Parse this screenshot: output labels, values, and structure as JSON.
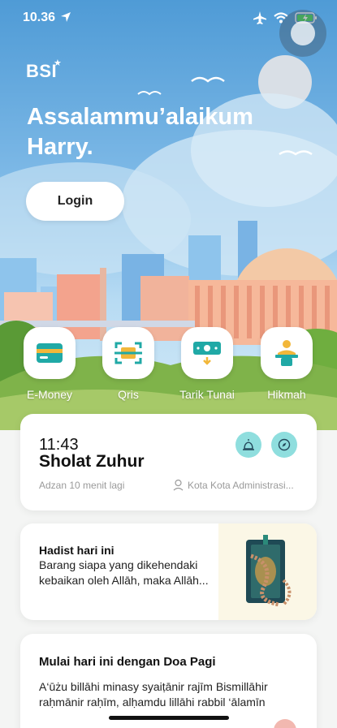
{
  "status_bar": {
    "time": "10.36"
  },
  "header": {
    "logo": "BSI",
    "greeting": "Assalammu’alaikum Harry.",
    "login_label": "Login"
  },
  "quick_menu": [
    {
      "label": "E-Money",
      "icon": "card-icon"
    },
    {
      "label": "Qris",
      "icon": "qr-scan-icon"
    },
    {
      "label": "Tarik Tunai",
      "icon": "cash-withdraw-icon"
    },
    {
      "label": "Hikmah",
      "icon": "reading-person-icon"
    }
  ],
  "prayer": {
    "time": "11:43",
    "name": "Sholat Zuhur",
    "note": "Adzan 10 menit lagi",
    "location": "Kota Kota Administrasi..."
  },
  "hadist": {
    "title": "Hadist hari ini",
    "text": "Barang siapa yang dikehendaki kebaikan oleh Allāh, maka Allāh..."
  },
  "doa": {
    "title": "Mulai hari ini dengan Doa Pagi",
    "text": "A‘ūżu billāhi minasy syaiṭānir rajīm Bismillāhir raḥmānir raḥīm, alḥamdu lillāhi rabbil ‘ālamīn"
  },
  "colors": {
    "accent_teal": "#1fa8a8",
    "teal_light": "#8fdede",
    "sky": "#7cb8e6"
  }
}
